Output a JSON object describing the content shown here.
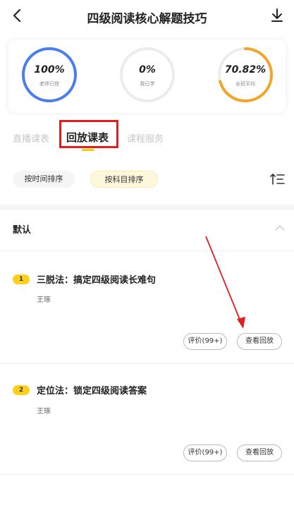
{
  "header": {
    "title": "四级阅读核心解题技巧"
  },
  "stats": [
    {
      "value": "100%",
      "label": "老师已授",
      "progress": 1.0,
      "color": "#4a7ef0"
    },
    {
      "value": "0%",
      "label": "我已学",
      "progress": 0.0,
      "color": "#e6e6e6"
    },
    {
      "value": "70.82%",
      "label": "全班平均",
      "progress": 0.7082,
      "color": "#f3a52a"
    }
  ],
  "tabs": [
    {
      "label": "直播课表",
      "active": false
    },
    {
      "label": "回放课表",
      "active": true
    },
    {
      "label": "课程服务",
      "active": false
    }
  ],
  "filters": [
    {
      "label": "按时间排序",
      "selected": false
    },
    {
      "label": "按科目排序",
      "selected": true
    }
  ],
  "section": {
    "title": "默认"
  },
  "lessons": [
    {
      "num": "1",
      "title": "三脱法：搞定四级阅读长难句",
      "teacher": "王琢",
      "buttons": [
        "评价(99+)",
        "查看回放"
      ]
    },
    {
      "num": "2",
      "title": "定位法：锁定四级阅读答案",
      "teacher": "王琢",
      "buttons": [
        "评价(99+)",
        "查看回放"
      ]
    }
  ],
  "colors": {
    "accent": "#ffcc00",
    "annotation": "#e02020"
  }
}
